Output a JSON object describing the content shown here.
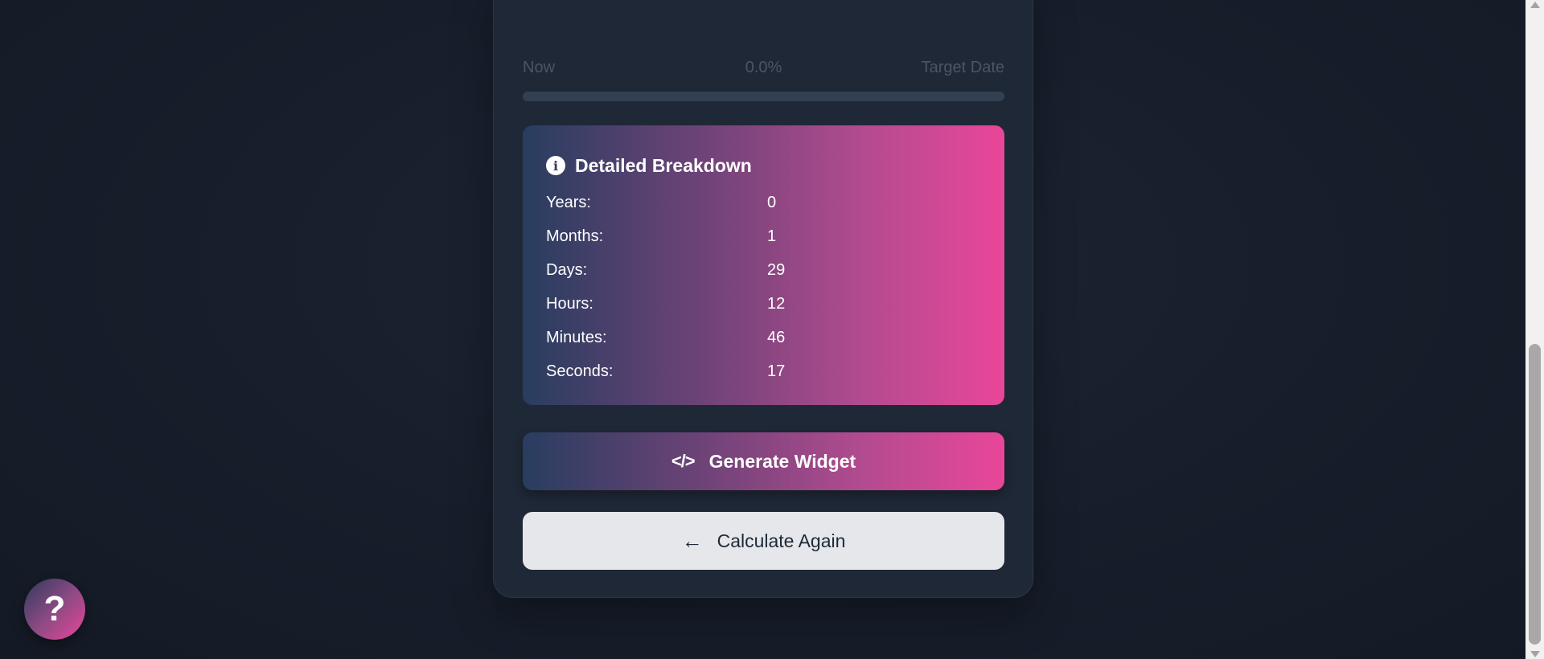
{
  "progress": {
    "start_label": "Now",
    "percent_label": "0.0%",
    "end_label": "Target Date",
    "fill_fraction": 0.0
  },
  "breakdown": {
    "title": "Detailed Breakdown",
    "icon": "info-icon",
    "rows": [
      {
        "label": "Years:",
        "value": "0"
      },
      {
        "label": "Months:",
        "value": "1"
      },
      {
        "label": "Days:",
        "value": "29"
      },
      {
        "label": "Hours:",
        "value": "12"
      },
      {
        "label": "Minutes:",
        "value": "46"
      },
      {
        "label": "Seconds:",
        "value": "17"
      }
    ]
  },
  "buttons": {
    "generate_label": "Generate Widget",
    "generate_icon": "code-icon",
    "again_label": "Calculate Again",
    "again_icon": "arrow-left-icon",
    "help_label": "?"
  },
  "colors": {
    "accent_pink": "#ea4699",
    "accent_navy": "#283d5f",
    "background": "#171e2b",
    "card": "#1f2836"
  }
}
